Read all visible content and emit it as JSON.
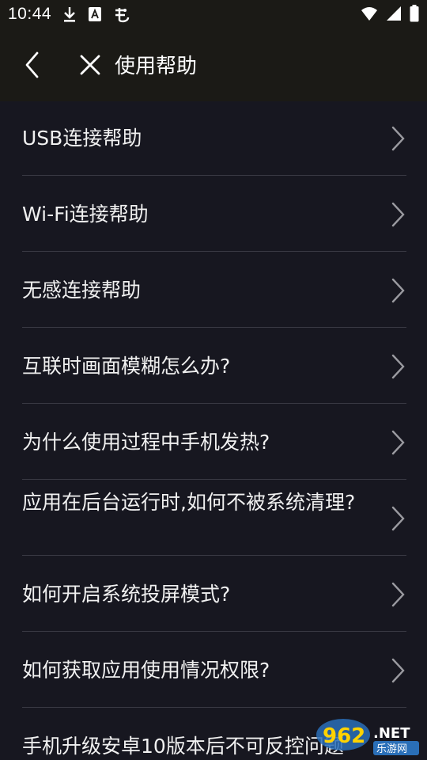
{
  "status_bar": {
    "time": "10:44",
    "left_icons": [
      "download-icon",
      "font-a-icon",
      "bug-icon"
    ],
    "right_icons": [
      "wifi-icon",
      "signal-icon",
      "battery-icon"
    ]
  },
  "toolbar": {
    "title": "使用帮助",
    "back_icon": "chevron-left-icon",
    "close_icon": "close-icon"
  },
  "help_items": [
    {
      "label": "USB连接帮助"
    },
    {
      "label": "Wi-Fi连接帮助"
    },
    {
      "label": "无感连接帮助"
    },
    {
      "label": "互联时画面模糊怎么办?"
    },
    {
      "label": "为什么使用过程中手机发热?"
    },
    {
      "label": "应用在后台运行时,如何不被系统清理?"
    },
    {
      "label": "如何开启系统投屏模式?"
    },
    {
      "label": "如何获取应用使用情况权限?"
    },
    {
      "label": "手机升级安卓10版本后不可反控问题"
    }
  ],
  "watermark": {
    "number": "962",
    "suffix": ".NET",
    "subtext": "乐游网"
  },
  "colors": {
    "background": "#171720",
    "toolbar": "#1b1a16",
    "divider": "#3a3a44",
    "chevron": "#9a9aa0"
  }
}
